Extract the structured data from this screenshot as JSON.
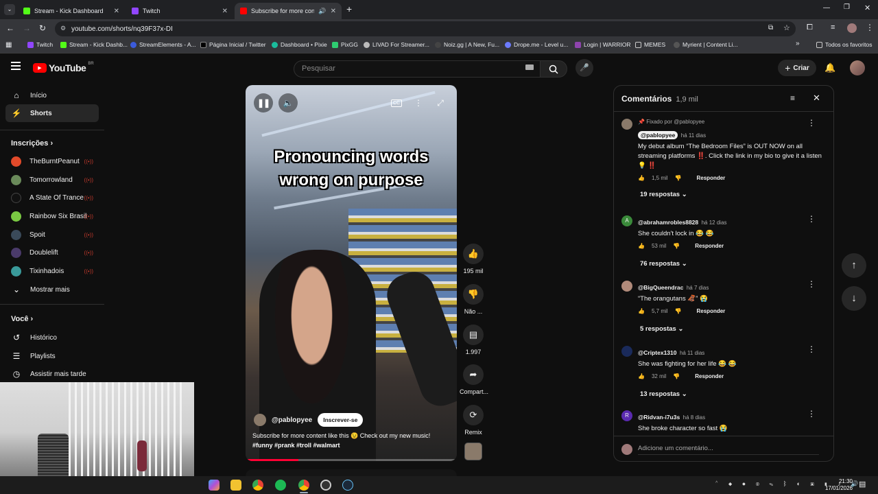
{
  "browser": {
    "tabs": [
      {
        "title": "Stream - Kick Dashboard",
        "favicon_color": "#53fc18"
      },
      {
        "title": "Twitch",
        "favicon_color": "#9146ff"
      },
      {
        "title": "Subscribe for more content",
        "favicon_color": "#ff0000"
      }
    ],
    "new_tab": "+",
    "url": "youtube.com/shorts/nq39F37x-DI",
    "bookmarks": [
      "Twitch",
      "Stream - Kick Dashb...",
      "StreamElements - A...",
      "Página Inicial / Twitter",
      "Dashboard • Pixie",
      "PixGG",
      "LIVAD For Streamer...",
      "Noiz.gg | A New, Fu...",
      "Drope.me - Level u...",
      "Login | WARRIOR",
      "MEMES",
      "Myrient | Content Li..."
    ],
    "bookmarks_more": "»",
    "all_bookmarks": "Todos os favoritos"
  },
  "youtube": {
    "logo": "YouTube",
    "region": "BR",
    "search_placeholder": "Pesquisar",
    "create_label": "Criar"
  },
  "sidebar": {
    "main": [
      {
        "label": "Início",
        "icon": "home-icon"
      },
      {
        "label": "Shorts",
        "icon": "shorts-icon"
      }
    ],
    "subs_title": "Inscrições",
    "subs": [
      {
        "label": "TheBurntPeanut",
        "color": "#e24a2a",
        "live": true
      },
      {
        "label": "Tomorrowland",
        "color": "#6a8a5a",
        "live": true
      },
      {
        "label": "A State Of Trance",
        "color": "#111111",
        "live": true
      },
      {
        "label": "Rainbow Six Brasil",
        "color": "#7ac943",
        "live": true
      },
      {
        "label": "Spoit",
        "color": "#3a4a5a",
        "live": true
      },
      {
        "label": "Doublelift",
        "color": "#4a3a6a",
        "live": true
      },
      {
        "label": "Tixinhadois",
        "color": "#3a9a9a",
        "live": true
      }
    ],
    "show_more": "Mostrar mais",
    "you_title": "Você",
    "you": [
      {
        "label": "Histórico",
        "icon": "history-icon"
      },
      {
        "label": "Playlists",
        "icon": "playlist-icon"
      },
      {
        "label": "Assistir mais tarde",
        "icon": "clock-icon"
      }
    ]
  },
  "video": {
    "caption_line1": "Pronouncing words",
    "caption_line2": "wrong on purpose",
    "channel": "@pablopyee",
    "subscribe": "Inscrever-se",
    "description": "Subscribe for more content like this 😉 Check out my new music!",
    "hashtags": "#funny #prank #troll #walmart",
    "progress": 0.25
  },
  "actions": [
    {
      "label": "195 mil",
      "icon": "like-icon"
    },
    {
      "label": "Não ...",
      "icon": "dislike-icon"
    },
    {
      "label": "1.997",
      "icon": "comment-icon"
    },
    {
      "label": "Compart...",
      "icon": "share-icon"
    },
    {
      "label": "Remix",
      "icon": "remix-icon"
    }
  ],
  "comments": {
    "title": "Comentários",
    "count": "1,9 mil",
    "pinned_by": "Fixado por @pablopyee",
    "items": [
      {
        "author": "@pablopyee",
        "time": "há 11 dias",
        "text": "My debut album “The Bedroom Files” is OUT NOW on all streaming platforms ‼️. Click the link in my bio to give it a listen 💡 ‼️",
        "likes": "1,5 mil",
        "reply": "Responder",
        "replies": "19 respostas",
        "avatar_color": "#8a7a6a"
      },
      {
        "author": "@abrahamrobles8828",
        "time": "há 12 dias",
        "text": "She couldn't lock in 😂 😂",
        "likes": "53 mil",
        "reply": "Responder",
        "replies": "76 respostas",
        "avatar_color": "#3a8a3a",
        "initial": "A"
      },
      {
        "author": "@BigQueendrac",
        "time": "há 7 dias",
        "text": "“The orangutans 🦧” 😭",
        "likes": "5,7 mil",
        "reply": "Responder",
        "replies": "5 respostas",
        "avatar_color": "#b08a7a"
      },
      {
        "author": "@Criptex1310",
        "time": "há 11 dias",
        "text": "She was fighting for her life 😂 😂",
        "likes": "32 mil",
        "reply": "Responder",
        "replies": "13 respostas",
        "avatar_color": "#1a2a5a"
      },
      {
        "author": "@Ridvan-i7u3s",
        "time": "há 8 dias",
        "text": "She broke character so fast 😭",
        "likes": "",
        "reply": "",
        "replies": "",
        "avatar_color": "#5a2ab0",
        "initial": "R"
      }
    ],
    "add_placeholder": "Adicione um comentário..."
  },
  "taskbar": {
    "time": "21:30",
    "date": "17/01/2026"
  }
}
